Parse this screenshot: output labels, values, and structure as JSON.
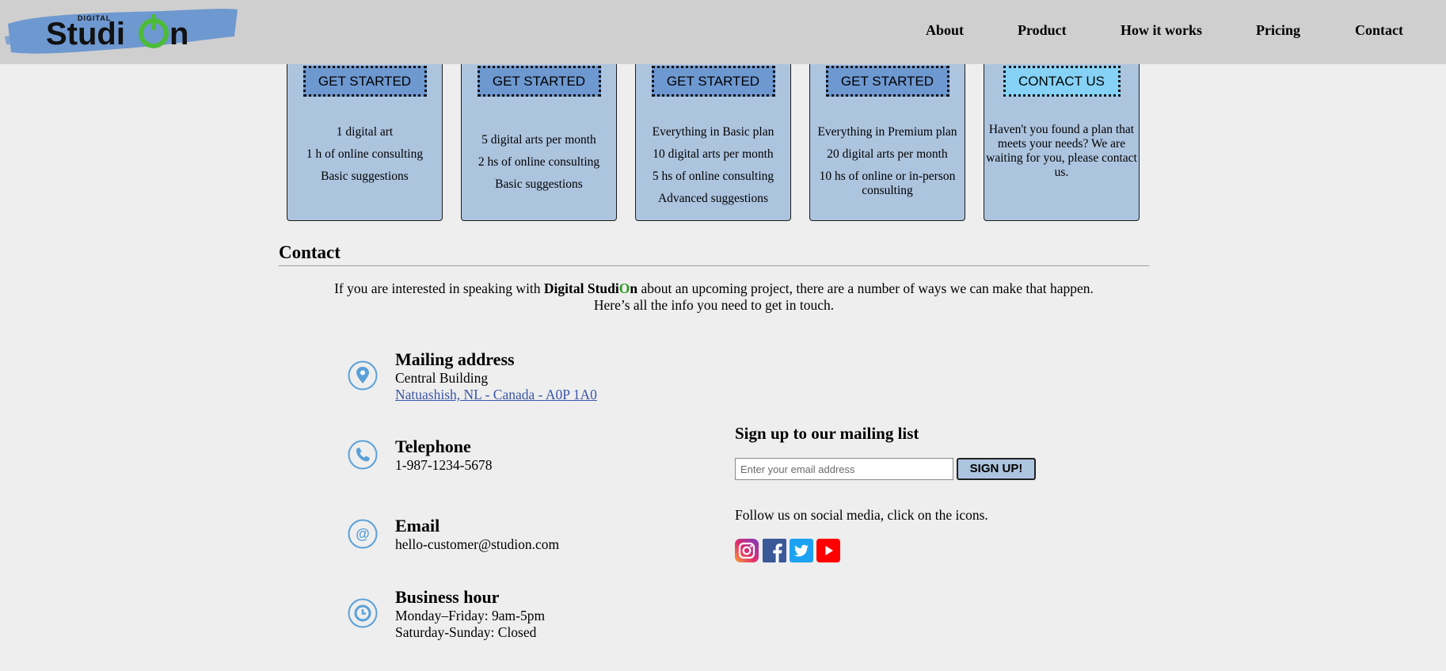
{
  "header": {
    "logo_small_text": "DIGITAL",
    "logo_text": "Studi",
    "logo_text_end": "n",
    "nav": [
      "About",
      "Product",
      "How it works",
      "Pricing",
      "Contact"
    ]
  },
  "pricing": {
    "cards": [
      {
        "button": "GET STARTED",
        "features": [
          "1 digital art",
          "1 h of online consulting",
          "Basic suggestions"
        ]
      },
      {
        "button": "GET STARTED",
        "features": [
          "5 digital arts per month",
          "2 hs of online consulting",
          "Basic suggestions"
        ]
      },
      {
        "button": "GET STARTED",
        "features": [
          "Everything in Basic plan",
          "10 digital arts per month",
          "5 hs of online consulting",
          "Advanced suggestions"
        ]
      },
      {
        "button": "GET STARTED",
        "features": [
          "Everything in Premium plan",
          "20 digital arts per month",
          "10 hs of online or in-person consulting"
        ]
      },
      {
        "button": "CONTACT US",
        "note": "Haven't you found a plan that meets your needs? We are waiting for you, please contact us."
      }
    ]
  },
  "contact": {
    "title": "Contact",
    "intro_before": "If you are interested in speaking with ",
    "brand_a": "Digital Studi",
    "brand_o": "O",
    "brand_b": "n",
    "intro_after": " about an upcoming project, there are a number of ways we can make that happen.",
    "intro_line2": "Here’s all the info you need to get in touch.",
    "mailing": {
      "title": "Mailing address",
      "line1": "Central Building",
      "link": "Natuashish, NL - Canada - A0P 1A0"
    },
    "telephone": {
      "title": "Telephone",
      "value": "1-987-1234-5678"
    },
    "email": {
      "title": "Email",
      "value": "hello-customer@studion.com"
    },
    "hours": {
      "title": "Business hour",
      "line1": "Monday–Friday: 9am-5pm",
      "line2": "Saturday-Sunday: Closed"
    }
  },
  "mailing_list": {
    "title": "Sign up to our mailing list",
    "placeholder": "Enter your email address",
    "button": "SIGN UP!",
    "follow_text": "Follow us on social media, click on the icons."
  },
  "social": [
    "instagram-icon",
    "facebook-icon",
    "twitter-icon",
    "youtube-icon"
  ],
  "colors": {
    "header_bg": "#cfcfcf",
    "card_bg": "#adc4df",
    "button_blue": "#6e98d0",
    "contact_button": "#86d2f6",
    "brand_green": "#2e9a24",
    "icon_blue": "#5aa0d8"
  }
}
